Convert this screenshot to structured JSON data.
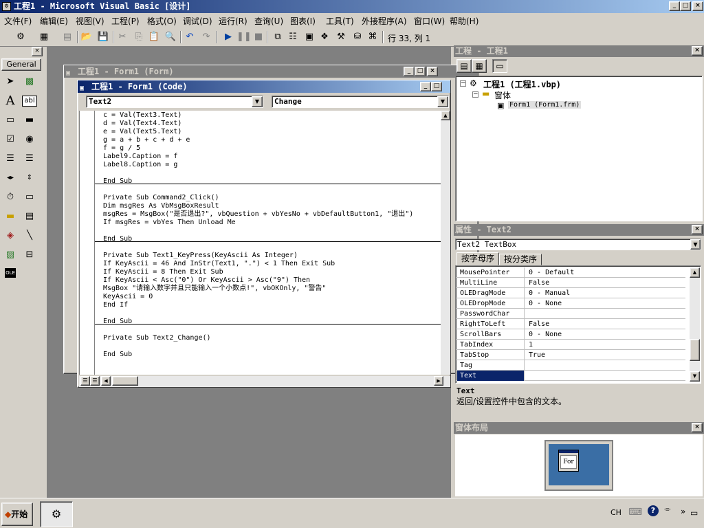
{
  "app": {
    "title": "工程1 - Microsoft Visual Basic [设计]",
    "caption_min": "_",
    "caption_max": "□",
    "caption_close": "×"
  },
  "menu": [
    "文件(F)",
    "编辑(E)",
    "视图(V)",
    "工程(P)",
    "格式(O)",
    "调试(D)",
    "运行(R)",
    "查询(U)",
    "图表(I)",
    "工具(T)",
    "外接程序(A)",
    "窗口(W)",
    "帮助(H)"
  ],
  "toolbar": {
    "position": "行 33, 列 1"
  },
  "toolbox": {
    "tab_label": "General",
    "tools": [
      "pointer",
      "picturebox",
      "label",
      "textbox",
      "frame",
      "commandbutton",
      "checkbox",
      "optionbutton",
      "combobox",
      "listbox",
      "hscrollbar",
      "vscrollbar",
      "timer",
      "drivelistbox",
      "dirlistbox",
      "filelistbox",
      "shape",
      "line",
      "image",
      "data",
      "ole"
    ],
    "label_glyph": "A",
    "textbox_glyph": "abl",
    "ole_glyph": "OLE"
  },
  "form_window": {
    "title": "工程1 - Form1 (Form)"
  },
  "code_window": {
    "title": "工程1 - Form1 (Code)",
    "object_combo": "Text2",
    "proc_combo": "Change",
    "lines": [
      "c = Val(Text3.Text)",
      "d = Val(Text4.Text)",
      "e = Val(Text5.Text)",
      "g = a + b + c + d + e",
      "f = g / 5",
      "Label9.Caption = f",
      "Label8.Caption = g",
      "",
      "End Sub",
      "",
      "Private Sub Command2_Click()",
      "Dim msgRes As VbMsgBoxResult",
      "msgRes = MsgBox(\"是否退出?\", vbQuestion + vbYesNo + vbDefaultButton1, \"退出\")",
      "If msgRes = vbYes Then Unload Me",
      "",
      "End Sub",
      "",
      "Private Sub Text1_KeyPress(KeyAscii As Integer)",
      "If KeyAscii = 46 And InStr(Text1, \".\") < 1 Then Exit Sub",
      "If KeyAscii = 8 Then Exit Sub",
      "If KeyAscii < Asc(\"0\") Or KeyAscii > Asc(\"9\") Then",
      "MsgBox \"请输入数字并且只能输入一个小数点!\", vbOKOnly, \"警告\"",
      "KeyAscii = 0",
      "End If",
      "",
      "End Sub",
      "",
      "Private Sub Text2_Change()",
      "",
      "End Sub"
    ]
  },
  "project": {
    "title": "工程 - 工程1",
    "root": "工程1 (工程1.vbp)",
    "folder": "窗体",
    "item": "Form1 (Form1.frm)"
  },
  "properties": {
    "title": "属性 - Text2",
    "object": "Text2 TextBox",
    "tab_alpha": "按字母序",
    "tab_category": "按分类序",
    "rows": [
      {
        "name": "MousePointer",
        "value": "0 - Default"
      },
      {
        "name": "MultiLine",
        "value": "False"
      },
      {
        "name": "OLEDragMode",
        "value": "0 - Manual"
      },
      {
        "name": "OLEDropMode",
        "value": "0 - None"
      },
      {
        "name": "PasswordChar",
        "value": ""
      },
      {
        "name": "RightToLeft",
        "value": "False"
      },
      {
        "name": "ScrollBars",
        "value": "0 - None"
      },
      {
        "name": "TabIndex",
        "value": "1"
      },
      {
        "name": "TabStop",
        "value": "True"
      },
      {
        "name": "Tag",
        "value": ""
      },
      {
        "name": "Text",
        "value": ""
      }
    ],
    "selected": "Text",
    "desc_title": "Text",
    "desc_text": "返回/设置控件中包含的文本。"
  },
  "layout_panel": {
    "title": "窗体布局",
    "thumb_label": "For"
  },
  "taskbar": {
    "start": "开始",
    "lang": "CH"
  }
}
